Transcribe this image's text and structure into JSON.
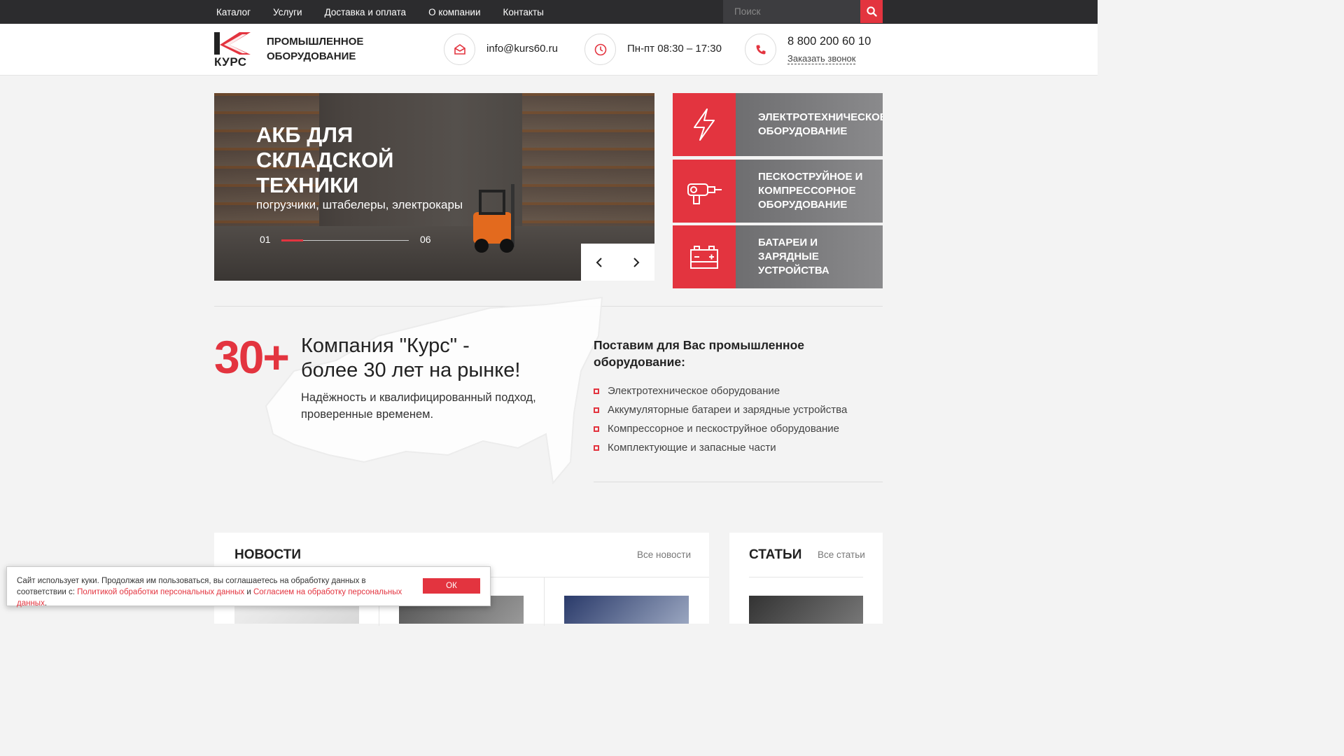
{
  "topnav": {
    "items": [
      "Каталог",
      "Услуги",
      "Доставка и оплата",
      "О компании",
      "Контакты"
    ],
    "search_placeholder": "Поиск"
  },
  "header": {
    "logo_text": "КУРС",
    "tagline_line1": "ПРОМЫШЛЕННОЕ",
    "tagline_line2": "ОБОРУДОВАНИЕ",
    "email": "info@kurs60.ru",
    "hours": "Пн-пт 08:30 – 17:30",
    "phone": "8 800 200 60 10",
    "callback": "Заказать звонок"
  },
  "slider": {
    "title_line1": "АКБ для",
    "title_line2": "складской",
    "title_line3": "техники",
    "subtitle": "погрузчики, штабелеры, электрокары",
    "current": "01",
    "total": "06",
    "progress": 0.17
  },
  "categories": [
    {
      "line1": "Электротехническое",
      "line2": "оборудование",
      "line3": "",
      "icon": "lightning-icon"
    },
    {
      "line1": "Пескоструйное и",
      "line2": "компрессорное",
      "line3": "оборудование",
      "icon": "sandblaster-icon"
    },
    {
      "line1": "Батареи и",
      "line2": "зарядные",
      "line3": "устройства",
      "icon": "battery-icon"
    }
  ],
  "about": {
    "big_number": "30+",
    "heading_line1": "Компания \"Курс\" -",
    "heading_line2": "более 30 лет на рынке!",
    "text_line1": "Надёжность и квалифицированный подход,",
    "text_line2": "проверенные временем."
  },
  "offer": {
    "heading_line1": "Поставим для Вас промышленное",
    "heading_line2": "оборудование:",
    "items": [
      "Электротехническое оборудование",
      "Аккумуляторные батареи и зарядные устройства",
      "Компрессорное и пескоструйное оборудование",
      "Комплектующие и запасные части"
    ]
  },
  "news": {
    "title": "НОВОСТИ",
    "all_link": "Все новости"
  },
  "articles": {
    "title": "СТАТЬИ",
    "all_link": "Все статьи"
  },
  "cookie": {
    "text1": "Сайт использует куки. Продолжая им пользоваться, вы соглашаетесь на обработку данных в соответствии с:",
    "link1": "Политикой обработки персональных данных",
    "and": "и",
    "link2": "Согласием на обработку персональных данных",
    "dot": ".",
    "ok": "ОК"
  },
  "colors": {
    "accent": "#e3343f",
    "topbar": "#2c2c2e"
  }
}
